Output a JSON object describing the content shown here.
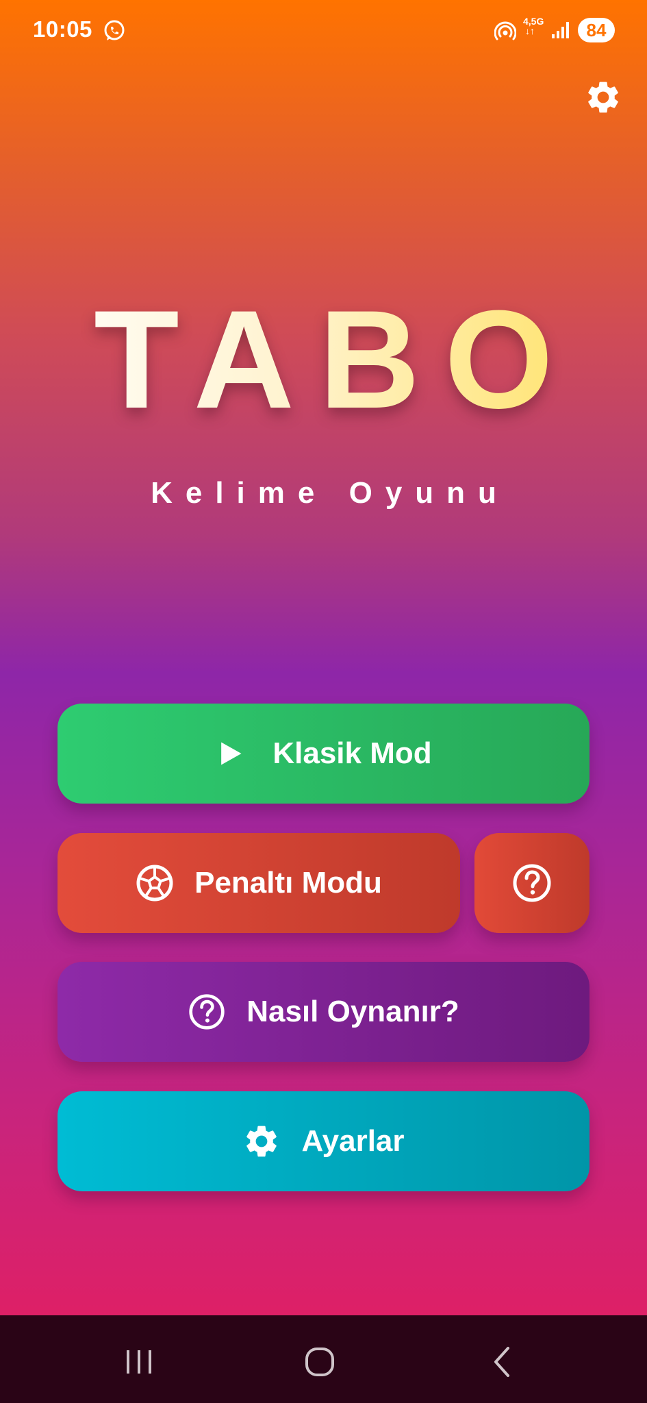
{
  "status_bar": {
    "time": "10:05",
    "network_type": "4,5G",
    "network_arrows": "↓↑",
    "battery": "84",
    "icons": [
      "whatsapp-icon",
      "hotspot-icon",
      "signal-icon"
    ]
  },
  "header": {
    "settings_icon": "gear-icon"
  },
  "app": {
    "title": "TABO",
    "subtitle": "Kelime Oyunu"
  },
  "menu": {
    "classic_mode": {
      "label": "Klasik Mod",
      "icon": "play-icon"
    },
    "penalty_mode": {
      "label": "Penaltı Modu",
      "icon": "soccer-ball-icon"
    },
    "penalty_help": {
      "icon": "help-icon"
    },
    "how_to_play": {
      "label": "Nasıl Oynanır?",
      "icon": "help-icon"
    },
    "settings": {
      "label": "Ayarlar",
      "icon": "gear-icon"
    }
  },
  "nav_bar": {
    "buttons": [
      "recents-icon",
      "home-icon",
      "back-icon"
    ]
  },
  "colors": {
    "gradient_top": "#ff7300",
    "gradient_middle": "#8e26a8",
    "gradient_bottom": "#e31f62",
    "classic_button": "#2ecc71",
    "penalty_button": "#e34c3b",
    "how_to_button": "#8e2aa8",
    "settings_button": "#00bcd4",
    "title_accent": "#ffe05a",
    "nav_bar": "#2a0416"
  }
}
